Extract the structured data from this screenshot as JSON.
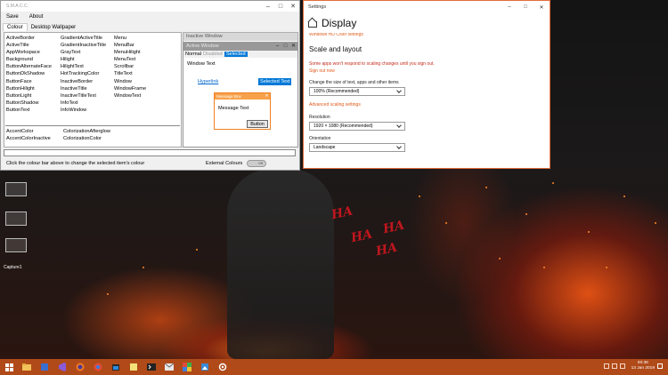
{
  "desktop": {
    "icon_label": "Capture1",
    "wallpaper_text": [
      "HA",
      "HA",
      "HA",
      "HA"
    ]
  },
  "smacc": {
    "title": "S.M.A.C.C.",
    "menu": [
      "Save",
      "About"
    ],
    "tabs": [
      "Colour",
      "Desktop Wallpaper"
    ],
    "col1": [
      "ActiveBorder",
      "ActiveTitle",
      "AppWorkspace",
      "Background",
      "ButtonAlternateFace",
      "ButtonDkShadow",
      "ButtonFace",
      "ButtonHilight",
      "ButtonLight",
      "ButtonShadow",
      "ButtonText"
    ],
    "col2": [
      "GradientActiveTitle",
      "GradientInactiveTitle",
      "GrayText",
      "Hilight",
      "HilightText",
      "HotTrackingColor",
      "InactiveBorder",
      "InactiveTitle",
      "InactiveTitleText",
      "InfoText",
      "InfoWindow"
    ],
    "col3": [
      "Menu",
      "MenuBar",
      "MenuHilight",
      "MenuText",
      "Scrollbar",
      "TitleText",
      "Window",
      "WindowFrame",
      "WindowText"
    ],
    "accent_row1": [
      "AccentColor",
      "ColorizationAfterglow"
    ],
    "accent_row2": [
      "AccentColorInactive",
      "ColorizationColor"
    ],
    "hint": "Click the colour bar above to change the selected item's colour",
    "external_colours": "External Colours",
    "toggle": "Off",
    "preview": {
      "inactive_title": "Inactive Window",
      "active_title": "Active Window",
      "states": [
        "Normal",
        "Disabled",
        "Selected"
      ],
      "window_text": "Window Text",
      "hyperlink": "Hyperlink",
      "selected_text": "Selected Text",
      "msgbox_title": "Message Box",
      "message_text": "Message Text",
      "button": "Button"
    }
  },
  "settings": {
    "window_title": "Settings",
    "page_title": "Display",
    "cut_link": "Windows HD Color settings",
    "section": "Scale and layout",
    "warning": "Some apps won't respond to scaling changes until you sign out.",
    "signout": "Sign out now",
    "scale_label": "Change the size of text, apps and other items",
    "scale_value": "100% (Recommended)",
    "advanced": "Advanced scaling settings",
    "resolution_label": "Resolution",
    "resolution_value": "1920 × 1080 (Recommended)",
    "orientation_label": "Orientation",
    "orientation_value": "Landscape"
  },
  "taskbar": {
    "time": "00:36",
    "date": "13 Jan 2019",
    "accent": "#b04a19"
  }
}
